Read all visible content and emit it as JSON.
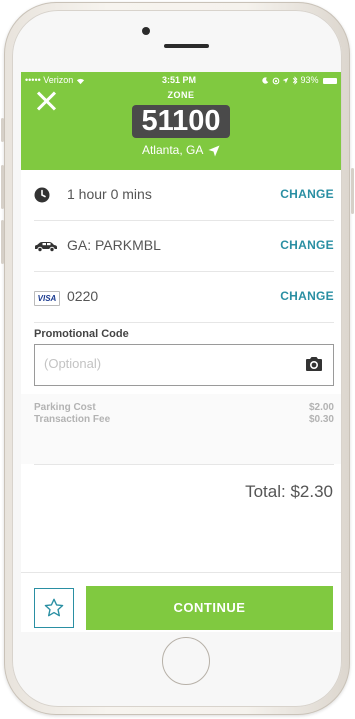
{
  "status_bar": {
    "carrier": "••••• Verizon",
    "time": "3:51 PM",
    "battery": "93%"
  },
  "header": {
    "zone_label": "ZONE",
    "zone_number": "51100",
    "city": "Atlanta, GA"
  },
  "rows": [
    {
      "icon": "clock-icon",
      "text": "1 hour 0 mins",
      "action": "CHANGE"
    },
    {
      "icon": "car-icon",
      "text": "GA: PARKMBL",
      "action": "CHANGE"
    },
    {
      "icon": "visa-card-icon",
      "brand": "VISA",
      "text": "0220",
      "action": "CHANGE"
    }
  ],
  "promo": {
    "label": "Promotional Code",
    "placeholder": "(Optional)",
    "value": ""
  },
  "costs": [
    {
      "label": "Parking Cost",
      "value": "$2.00"
    },
    {
      "label": "Transaction Fee",
      "value": "$0.30"
    }
  ],
  "total": "Total: $2.30",
  "continue_label": "CONTINUE",
  "colors": {
    "accent_green": "#80c940",
    "link_teal": "#2a8fa3",
    "zone_bg": "#4a4a4a"
  }
}
